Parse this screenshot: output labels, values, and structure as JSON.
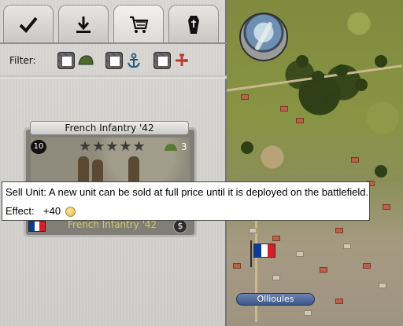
{
  "tabs": [
    {
      "name": "checkmark",
      "icon": "checkmark-icon"
    },
    {
      "name": "download",
      "icon": "download-icon"
    },
    {
      "name": "shop",
      "icon": "cart-icon",
      "active": true
    },
    {
      "name": "graveyard",
      "icon": "coffin-icon"
    }
  ],
  "filter": {
    "label": "Filter:",
    "options": [
      {
        "icon": "helmet-icon",
        "checked": false
      },
      {
        "icon": "anchor-icon",
        "checked": false
      },
      {
        "icon": "plane-icon",
        "checked": false
      }
    ]
  },
  "unit_card": {
    "title": "French Infantry '42",
    "level": "10",
    "stars": "★★★★★",
    "strength": "3",
    "name_bottom": "French Infantry '42",
    "sell_symbol": "$",
    "flag_colors": [
      "#0b3a9a",
      "#ffffff",
      "#d21f2b"
    ]
  },
  "tooltip": {
    "text": "Sell Unit: A new unit can be sold at full price until it is deployed on the battlefield.",
    "effect_label": "Effect:",
    "effect_value": "+40"
  },
  "map": {
    "city_label": "Ollioules"
  },
  "colors": {
    "accent_gold": "#d6c46b",
    "tooltip_bg": "#ffffff",
    "city_label_bg": "#4a629a"
  }
}
